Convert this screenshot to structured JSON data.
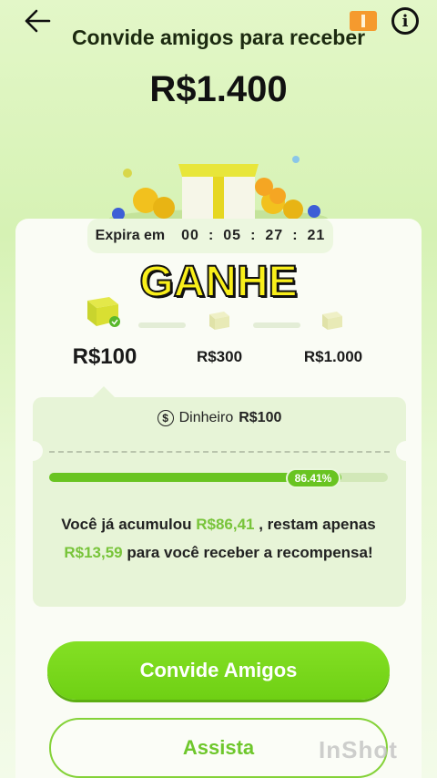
{
  "header": {
    "title": "Convide amigos para receber",
    "amount": "R$1.400"
  },
  "timer": {
    "label": "Expira em",
    "hours": "00",
    "minutes": "05",
    "seconds": "27",
    "extra": "21",
    "separator": ":"
  },
  "overlay": {
    "text": "GANHE"
  },
  "tiers": [
    {
      "label": "R$100",
      "active": true
    },
    {
      "label": "R$300",
      "active": false
    },
    {
      "label": "R$1.000",
      "active": false
    }
  ],
  "reward": {
    "cash_label": "Dinheiro",
    "cash_value": "R$100",
    "progress_percent": 86.41,
    "progress_text": "86.41%",
    "message_before": "Você já acumulou ",
    "accumulated": "R$86,41",
    "message_mid": " , restam apenas ",
    "remaining": "R$13,59",
    "message_after": " para você receber a recompensa!"
  },
  "buttons": {
    "invite": "Convide Amigos",
    "watch": "Assista"
  },
  "watermark": "InShot",
  "colors": {
    "accent": "#6fd014",
    "highlight": "#78c43a",
    "overlay_yellow": "#f9ef1a"
  }
}
